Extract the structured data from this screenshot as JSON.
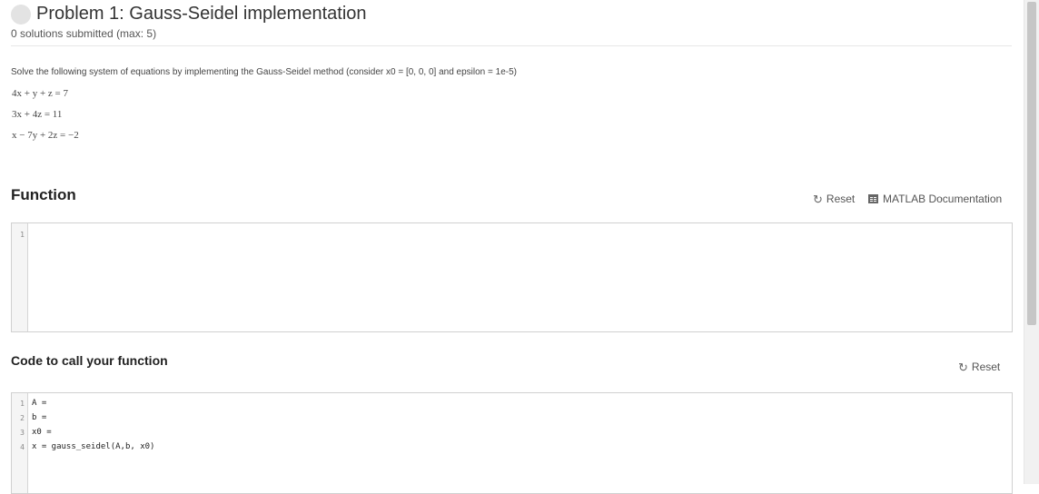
{
  "problem": {
    "title": "Problem 1: Gauss-Seidel implementation",
    "submissions": "0 solutions submitted (max: 5)",
    "description": "Solve the following system of equations by implementing the Gauss-Seidel method (consider x0 = [0, 0, 0] and epsilon = 1e-5)",
    "equations": [
      "4x + y + z = 7",
      "3x + 4z = 11",
      "x − 7y + 2z = −2"
    ]
  },
  "function_section": {
    "title": "Function",
    "reset_label": "Reset",
    "docs_label": "MATLAB Documentation",
    "lines": [
      {
        "num": "1",
        "code": ""
      }
    ]
  },
  "call_section": {
    "title": "Code to call your function",
    "reset_label": "Reset",
    "lines": [
      {
        "num": "1",
        "code": "A ="
      },
      {
        "num": "2",
        "code": "b ="
      },
      {
        "num": "3",
        "code": "x0 ="
      },
      {
        "num": "4",
        "code": "x = gauss_seidel(A,b, x0)"
      }
    ]
  },
  "icons": {
    "status": "status-circle-icon",
    "reset": "reset-icon",
    "documentation": "documentation-icon"
  }
}
